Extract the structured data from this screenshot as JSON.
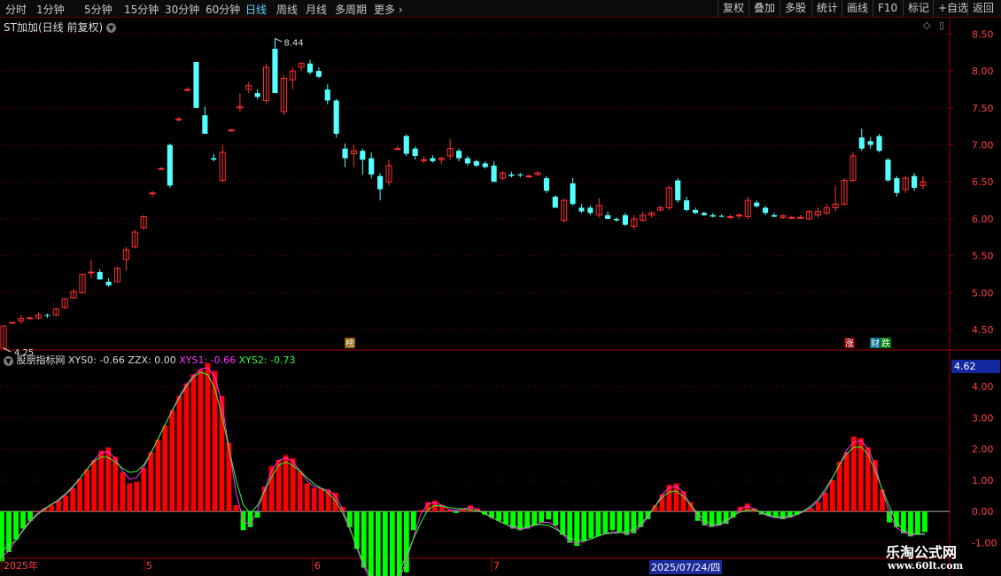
{
  "toolbar": {
    "periods": [
      "分时",
      "1分钟",
      "5分钟",
      "15分钟",
      "30分钟",
      "60分钟",
      "日线",
      "周线",
      "月线",
      "多周期",
      "更多"
    ],
    "active_period": "日线",
    "right_buttons": [
      "复权",
      "叠加",
      "多股",
      "统计",
      "画线",
      "F10",
      "标记",
      "+自选",
      "返回"
    ]
  },
  "header": {
    "title": "ST加加(日线 前复权)",
    "high_label": "8.44",
    "low_label": "4.25"
  },
  "indicator": {
    "name": "股朋指标网",
    "xys0": "XYS0: -0.66",
    "zzx": "ZZX: 0.00",
    "xys1": "XYS1: -0.66",
    "xys2": "XYS2: -0.73",
    "crosshair_value": "4.62"
  },
  "markers": {
    "rank": "榜",
    "limit_up": "涨",
    "fall": "跌",
    "fin": "财"
  },
  "timeline": {
    "labels": [
      "2025年",
      "5",
      "6",
      "7"
    ],
    "cursor_date": "2025/07/24/四"
  },
  "watermark": {
    "line1": "乐淘公式网",
    "line2": "www.60lt.com"
  },
  "colors": {
    "up": "#ff3232",
    "down": "#54ffff",
    "hist_up": "#ff0000",
    "hist_down": "#00ff00",
    "grid": "#7a0000",
    "xys1": "#ff33ff",
    "xys2": "#33ff33"
  },
  "chart_data": [
    {
      "type": "candlestick",
      "title": "ST加加(日线 前复权)",
      "y_ticks": [
        8.5,
        8.0,
        7.5,
        7.0,
        6.5,
        6.0,
        5.5,
        5.0,
        4.5
      ],
      "ylim": [
        4.25,
        8.6
      ],
      "candles": [
        [
          4.25,
          4.55,
          4.25,
          4.55
        ],
        [
          4.6,
          4.6,
          4.6,
          4.6
        ],
        [
          4.62,
          4.7,
          4.58,
          4.65
        ],
        [
          4.66,
          4.68,
          4.64,
          4.66
        ],
        [
          4.66,
          4.74,
          4.64,
          4.7
        ],
        [
          4.7,
          4.72,
          4.66,
          4.69
        ],
        [
          4.7,
          4.8,
          4.68,
          4.78
        ],
        [
          4.8,
          4.92,
          4.78,
          4.92
        ],
        [
          4.93,
          5.05,
          4.92,
          5.02
        ],
        [
          5.0,
          5.25,
          5.0,
          5.25
        ],
        [
          5.28,
          5.45,
          5.2,
          5.28
        ],
        [
          5.28,
          5.32,
          5.18,
          5.18
        ],
        [
          5.15,
          5.2,
          5.08,
          5.1
        ],
        [
          5.15,
          5.35,
          5.15,
          5.33
        ],
        [
          5.45,
          5.62,
          5.3,
          5.58
        ],
        [
          5.62,
          5.85,
          5.6,
          5.82
        ],
        [
          5.88,
          6.05,
          5.85,
          6.03
        ],
        [
          6.35,
          6.38,
          6.3,
          6.35
        ],
        [
          6.68,
          6.7,
          6.66,
          6.68
        ],
        [
          7.0,
          7.02,
          6.42,
          6.45
        ],
        [
          7.35,
          7.38,
          7.32,
          7.35
        ],
        [
          7.75,
          7.78,
          7.72,
          7.75
        ],
        [
          8.12,
          8.12,
          7.5,
          7.5
        ],
        [
          7.4,
          7.52,
          7.15,
          7.15
        ],
        [
          6.82,
          6.88,
          6.78,
          6.8
        ],
        [
          6.52,
          7.0,
          6.5,
          6.9
        ],
        [
          7.2,
          7.22,
          7.18,
          7.2
        ],
        [
          7.5,
          7.7,
          7.45,
          7.52
        ],
        [
          7.75,
          7.85,
          7.7,
          7.8
        ],
        [
          7.7,
          7.75,
          7.62,
          7.65
        ],
        [
          7.6,
          8.1,
          7.55,
          8.05
        ],
        [
          8.3,
          8.44,
          7.7,
          7.7
        ],
        [
          7.45,
          7.95,
          7.4,
          7.9
        ],
        [
          7.88,
          8.05,
          7.75,
          8.0
        ],
        [
          8.05,
          8.12,
          8.0,
          8.1
        ],
        [
          8.1,
          8.15,
          7.95,
          7.98
        ],
        [
          8.0,
          8.05,
          7.9,
          7.92
        ],
        [
          7.75,
          7.82,
          7.55,
          7.6
        ],
        [
          7.6,
          7.62,
          7.1,
          7.15
        ],
        [
          6.95,
          7.02,
          6.7,
          6.82
        ],
        [
          6.88,
          7.0,
          6.7,
          6.92
        ],
        [
          6.92,
          6.95,
          6.6,
          6.8
        ],
        [
          6.82,
          6.9,
          6.55,
          6.6
        ],
        [
          6.58,
          6.62,
          6.25,
          6.4
        ],
        [
          6.5,
          6.8,
          6.45,
          6.72
        ],
        [
          6.95,
          6.98,
          6.93,
          6.95
        ],
        [
          7.12,
          7.14,
          6.85,
          6.88
        ],
        [
          6.95,
          6.98,
          6.8,
          6.85
        ],
        [
          6.8,
          6.85,
          6.75,
          6.8
        ],
        [
          6.82,
          6.86,
          6.76,
          6.78
        ],
        [
          6.8,
          6.84,
          6.74,
          6.82
        ],
        [
          6.85,
          7.08,
          6.8,
          6.95
        ],
        [
          6.92,
          6.95,
          6.78,
          6.82
        ],
        [
          6.82,
          6.85,
          6.72,
          6.75
        ],
        [
          6.78,
          6.8,
          6.7,
          6.72
        ],
        [
          6.75,
          6.78,
          6.68,
          6.7
        ],
        [
          6.72,
          6.78,
          6.5,
          6.5
        ],
        [
          6.55,
          6.65,
          6.52,
          6.62
        ],
        [
          6.6,
          6.64,
          6.56,
          6.58
        ],
        [
          6.6,
          6.62,
          6.56,
          6.59
        ],
        [
          6.58,
          6.6,
          6.55,
          6.58
        ],
        [
          6.6,
          6.65,
          6.58,
          6.62
        ],
        [
          6.55,
          6.58,
          6.35,
          6.38
        ],
        [
          6.3,
          6.32,
          6.15,
          6.15
        ],
        [
          5.98,
          6.28,
          5.95,
          6.25
        ],
        [
          6.48,
          6.55,
          6.18,
          6.2
        ],
        [
          6.15,
          6.2,
          6.08,
          6.1
        ],
        [
          6.15,
          6.18,
          6.05,
          6.08
        ],
        [
          6.05,
          6.28,
          6.02,
          6.18
        ],
        [
          6.05,
          6.1,
          6.0,
          6.0
        ],
        [
          6.0,
          6.02,
          5.96,
          5.98
        ],
        [
          6.05,
          6.08,
          5.9,
          5.92
        ],
        [
          5.9,
          6.05,
          5.85,
          6.0
        ],
        [
          5.98,
          6.1,
          5.96,
          6.05
        ],
        [
          6.05,
          6.1,
          6.02,
          6.08
        ],
        [
          6.12,
          6.18,
          6.1,
          6.15
        ],
        [
          6.15,
          6.45,
          6.12,
          6.42
        ],
        [
          6.52,
          6.55,
          6.22,
          6.25
        ],
        [
          6.25,
          6.3,
          6.1,
          6.12
        ],
        [
          6.12,
          6.15,
          6.06,
          6.08
        ],
        [
          6.08,
          6.1,
          6.04,
          6.05
        ],
        [
          6.05,
          6.08,
          6.02,
          6.03
        ],
        [
          6.04,
          6.06,
          6.02,
          6.03
        ],
        [
          6.02,
          6.06,
          6.0,
          6.03
        ],
        [
          6.04,
          6.08,
          6.0,
          6.05
        ],
        [
          6.03,
          6.3,
          6.0,
          6.25
        ],
        [
          6.22,
          6.25,
          6.15,
          6.17
        ],
        [
          6.15,
          6.18,
          6.05,
          6.08
        ],
        [
          6.05,
          6.08,
          6.02,
          6.03
        ],
        [
          6.02,
          6.06,
          6.0,
          6.04
        ],
        [
          6.02,
          6.04,
          6.0,
          6.02
        ],
        [
          6.02,
          6.05,
          6.0,
          6.02
        ],
        [
          6.0,
          6.12,
          5.98,
          6.1
        ],
        [
          6.05,
          6.15,
          6.02,
          6.1
        ],
        [
          6.08,
          6.2,
          6.05,
          6.15
        ],
        [
          6.15,
          6.45,
          6.1,
          6.2
        ],
        [
          6.2,
          6.55,
          6.18,
          6.52
        ],
        [
          6.52,
          6.9,
          6.5,
          6.85
        ],
        [
          7.1,
          7.22,
          6.92,
          6.95
        ],
        [
          7.05,
          7.1,
          6.95,
          7.0
        ],
        [
          7.12,
          7.15,
          6.9,
          6.92
        ],
        [
          6.8,
          6.82,
          6.5,
          6.52
        ],
        [
          6.55,
          6.58,
          6.3,
          6.35
        ],
        [
          6.4,
          6.58,
          6.35,
          6.55
        ],
        [
          6.58,
          6.62,
          6.38,
          6.42
        ],
        [
          6.45,
          6.58,
          6.4,
          6.5
        ]
      ]
    },
    {
      "type": "bar+line",
      "title": "股朋指标网",
      "y_ticks": [
        4.0,
        3.0,
        2.0,
        1.0,
        0.0,
        -1.0
      ],
      "ylim": [
        -1.5,
        4.8
      ],
      "series": [
        {
          "name": "XYS0",
          "values": [
            -1.6,
            -1.3,
            -0.9,
            -0.55,
            -0.3,
            0,
            0.1,
            0.2,
            0.35,
            0.5,
            0.75,
            1.05,
            1.35,
            1.65,
            1.95,
            2.05,
            1.75,
            1.25,
            0.9,
            0.95,
            1.4,
            1.9,
            2.3,
            2.75,
            3.25,
            3.7,
            4.1,
            4.4,
            4.55,
            4.75,
            4.5,
            3.7,
            2.2,
            0.2,
            -0.6,
            -0.5,
            -0.2,
            0.8,
            1.45,
            1.65,
            1.8,
            1.7,
            1.3,
            0.9,
            0.75,
            0.75,
            0.7,
            0.6,
            0.15,
            -0.5,
            -1.2,
            -1.8,
            -2.3,
            -2.65,
            -2.55,
            -2.35,
            -2.15,
            -1.95,
            -0.6,
            0.05,
            0.3,
            0.35,
            0.2,
            0.05,
            -0.05,
            0.1,
            0.2,
            0.1,
            -0.1,
            -0.2,
            -0.3,
            -0.4,
            -0.55,
            -0.6,
            -0.55,
            -0.45,
            -0.35,
            -0.25,
            -0.45,
            -0.75,
            -1.0,
            -1.1,
            -0.95,
            -0.85,
            -0.8,
            -0.7,
            -0.6,
            -0.65,
            -0.75,
            -0.7,
            -0.5,
            -0.25,
            0.2,
            0.55,
            0.85,
            0.9,
            0.65,
            0.3,
            -0.3,
            -0.45,
            -0.5,
            -0.45,
            -0.4,
            -0.2,
            0.15,
            0.25,
            0.1,
            -0.1,
            -0.15,
            -0.2,
            -0.25,
            -0.2,
            -0.1,
            0,
            0.1,
            0.3,
            0.6,
            1.0,
            1.6,
            1.9,
            2.4,
            2.35,
            2.05,
            1.65,
            0.7,
            -0.35,
            -0.5,
            -0.7,
            -0.8,
            -0.75,
            -0.66
          ]
        },
        {
          "name": "XYS1",
          "values": []
        },
        {
          "name": "XYS2",
          "values": []
        }
      ]
    }
  ]
}
